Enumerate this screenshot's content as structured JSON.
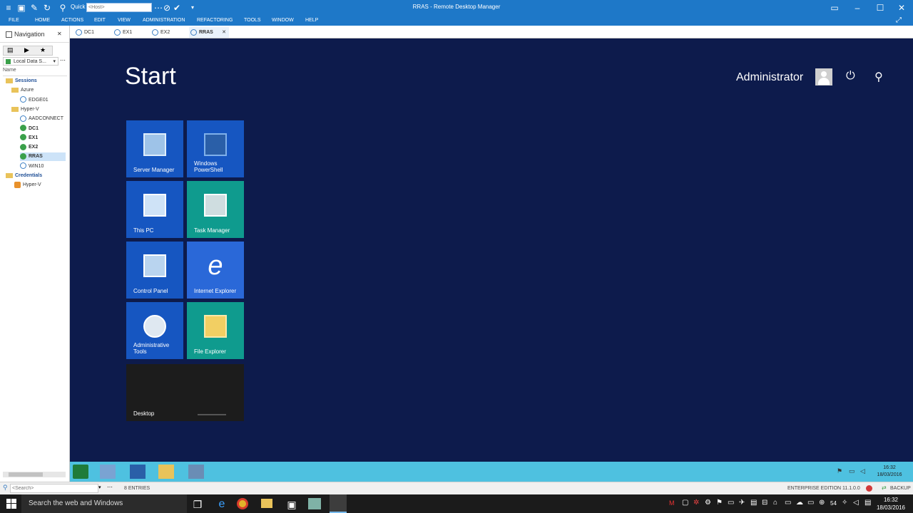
{
  "window": {
    "title": "RRAS - Remote Desktop Manager",
    "quick_label": "Quick",
    "host_placeholder": "<Host>"
  },
  "menu": [
    "FILE",
    "HOME",
    "ACTIONS",
    "EDIT",
    "VIEW",
    "ADMINISTRATION",
    "REFACTORING",
    "TOOLS",
    "WINDOW",
    "HELP"
  ],
  "tabs": [
    {
      "label": "DC1",
      "active": false
    },
    {
      "label": "EX1",
      "active": false
    },
    {
      "label": "EX2",
      "active": false
    },
    {
      "label": "RRAS",
      "active": true
    }
  ],
  "navigation": {
    "title": "Navigation",
    "data_source": "Local Data S...",
    "column_name": "Name",
    "tree": [
      {
        "label": "Sessions",
        "type": "folder",
        "bold": true
      },
      {
        "label": "Azure",
        "type": "folder"
      },
      {
        "label": "EDGE01",
        "type": "session-off"
      },
      {
        "label": "Hyper-V",
        "type": "folder"
      },
      {
        "label": "AADCONNECT",
        "type": "session-off"
      },
      {
        "label": "DC1",
        "type": "session-on",
        "bold": true
      },
      {
        "label": "EX1",
        "type": "session-on",
        "bold": true
      },
      {
        "label": "EX2",
        "type": "session-on",
        "bold": true
      },
      {
        "label": "RRAS",
        "type": "session-on",
        "bold": true,
        "selected": true
      },
      {
        "label": "WIN10",
        "type": "session-off"
      },
      {
        "label": "Credentials",
        "type": "folder",
        "bold": true
      },
      {
        "label": "Hyper-V",
        "type": "credential"
      }
    ]
  },
  "remote": {
    "start_title": "Start",
    "user": "Administrator",
    "tiles": [
      {
        "label": "Server Manager",
        "color": "#1656c1",
        "icon": "server-manager-icon"
      },
      {
        "label": "Windows PowerShell",
        "color": "#1656c1",
        "icon": "powershell-icon"
      },
      {
        "label": "This PC",
        "color": "#1656c1",
        "icon": "this-pc-icon"
      },
      {
        "label": "Task Manager",
        "color": "#0f9b8e",
        "icon": "task-manager-icon"
      },
      {
        "label": "Control Panel",
        "color": "#1656c1",
        "icon": "control-panel-icon"
      },
      {
        "label": "Internet Explorer",
        "color": "#2a68d8",
        "icon": "internet-explorer-icon"
      },
      {
        "label": "Administrative Tools",
        "color": "#1656c1",
        "icon": "admin-tools-icon"
      },
      {
        "label": "File Explorer",
        "color": "#0f9b8e",
        "icon": "file-explorer-icon"
      }
    ],
    "desktop_tile": "Desktop",
    "clock_time": "16:32",
    "clock_date": "18/03/2016"
  },
  "status": {
    "search_placeholder": "<Search>",
    "entries": "8 ENTRIES",
    "edition": "ENTERPRISE EDITION 11.1.0.0",
    "backup": "BACKUP"
  },
  "win_taskbar": {
    "search_text": "Search the web and Windows",
    "tray_number": "54",
    "time": "16:32",
    "date": "18/03/2016"
  }
}
